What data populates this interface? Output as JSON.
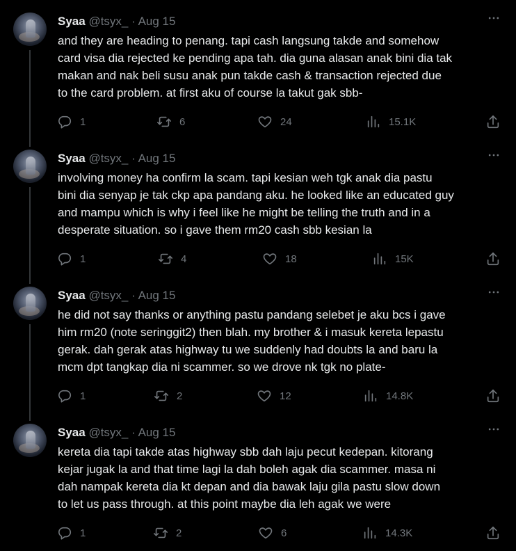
{
  "tweets": [
    {
      "name": "Syaa",
      "handle": "@tsyx_",
      "sep": "·",
      "date": "Aug 15",
      "lines": [
        "and they are heading to penang. tapi cash langsung takde and somehow",
        "card visa dia rejected ke pending apa tah. dia guna alasan anak bini dia tak",
        "makan and nak beli susu anak pun takde cash & transaction rejected due",
        "to the card problem. at first aku of course la takut gak sbb-"
      ],
      "replies": "1",
      "retweets": "6",
      "likes": "24",
      "views": "15.1K"
    },
    {
      "name": "Syaa",
      "handle": "@tsyx_",
      "sep": "·",
      "date": "Aug 15",
      "lines": [
        "involving money ha confirm la scam. tapi kesian weh tgk anak dia pastu",
        "bini dia senyap je tak ckp apa pandang aku. he looked like an educated guy",
        "and mampu which is why i feel like he might be telling the truth and in a",
        "desperate situation. so i gave them rm20 cash sbb kesian la"
      ],
      "replies": "1",
      "retweets": "4",
      "likes": "18",
      "views": "15K"
    },
    {
      "name": "Syaa",
      "handle": "@tsyx_",
      "sep": "·",
      "date": "Aug 15",
      "lines": [
        "he did not say thanks or anything pastu pandang selebet je aku bcs i gave",
        "him rm20 (note seringgit2) then blah. my brother & i masuk kereta lepastu",
        "gerak. dah gerak atas highway tu we suddenly had doubts la and baru la",
        "mcm dpt tangkap dia ni scammer. so we drove nk tgk no plate-"
      ],
      "replies": "1",
      "retweets": "2",
      "likes": "12",
      "views": "14.8K"
    },
    {
      "name": "Syaa",
      "handle": "@tsyx_",
      "sep": "·",
      "date": "Aug 15",
      "lines": [
        "kereta dia tapi takde atas highway sbb dah laju pecut kedepan. kitorang",
        "kejar jugak la and that time lagi la dah boleh agak dia scammer. masa ni",
        "dah nampak kereta dia kt depan and dia bawak laju gila pastu slow down",
        "to let us pass through. at this point maybe dia leh agak we were"
      ],
      "replies": "1",
      "retweets": "2",
      "likes": "6",
      "views": "14.3K"
    }
  ],
  "icons": {
    "reply": "reply-icon",
    "retweet": "retweet-icon",
    "like": "heart-icon",
    "views": "views-icon",
    "share": "share-icon",
    "more": "more-icon"
  },
  "colors": {
    "background": "#000000",
    "text": "#e7e9ea",
    "muted": "#71767b",
    "thread_line": "#333639"
  }
}
